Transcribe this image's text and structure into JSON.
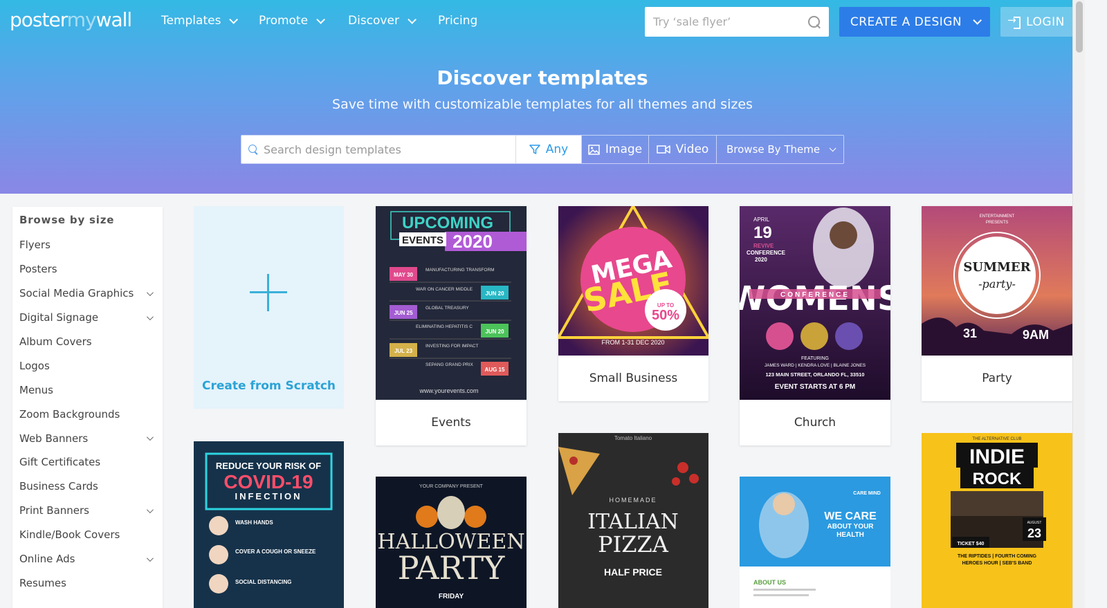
{
  "brand": {
    "logo_left": "poster",
    "logo_mid": "my",
    "logo_right": "wall"
  },
  "nav": {
    "items": [
      {
        "label": "Templates",
        "dropdown": true
      },
      {
        "label": "Promote",
        "dropdown": true
      },
      {
        "label": "Discover",
        "dropdown": true
      },
      {
        "label": "Pricing",
        "dropdown": false
      }
    ],
    "search_placeholder": "Try ‘sale flyer’",
    "create_label": "CREATE A DESIGN",
    "login_label": "LOGIN"
  },
  "hero": {
    "title": "Discover templates",
    "subtitle": "Save time with customizable templates for all themes and sizes"
  },
  "filter": {
    "search_placeholder": "Search design templates",
    "any_label": "Any",
    "image_label": "Image",
    "video_label": "Video",
    "theme_label": "Browse By Theme"
  },
  "sidebar": {
    "title": "Browse by size",
    "items": [
      {
        "label": "Flyers",
        "expandable": false
      },
      {
        "label": "Posters",
        "expandable": false
      },
      {
        "label": "Social Media Graphics",
        "expandable": true
      },
      {
        "label": "Digital Signage",
        "expandable": true
      },
      {
        "label": "Album Covers",
        "expandable": false
      },
      {
        "label": "Logos",
        "expandable": false
      },
      {
        "label": "Menus",
        "expandable": false
      },
      {
        "label": "Zoom Backgrounds",
        "expandable": false
      },
      {
        "label": "Web Banners",
        "expandable": true
      },
      {
        "label": "Gift Certificates",
        "expandable": false
      },
      {
        "label": "Business Cards",
        "expandable": false
      },
      {
        "label": "Print Banners",
        "expandable": true
      },
      {
        "label": "Kindle/Book Covers",
        "expandable": false
      },
      {
        "label": "Online Ads",
        "expandable": true
      },
      {
        "label": "Resumes",
        "expandable": false
      }
    ]
  },
  "grid": {
    "scratch_label": "Create from Scratch",
    "cards": {
      "events": "Events",
      "small_business": "Small Business",
      "church": "Church",
      "party": "Party"
    },
    "posters": {
      "events": {
        "title1": "UPCOMING",
        "title2": "EVENTS",
        "year": "2020",
        "rows": [
          {
            "date": "MAY 30",
            "text": "MANUFACTURING TRANSFORM"
          },
          {
            "date": "JUN 20",
            "text": "WAR ON CANCER MIDDLE"
          },
          {
            "date": "JUN 25",
            "text": "GLOBAL TREASURY"
          },
          {
            "date": "JUN 20",
            "text": "ELIMINATING HEPATITIS C"
          },
          {
            "date": "JUL 23",
            "text": "INVESTING FOR IMPACT"
          },
          {
            "date": "AUG 15",
            "text": "SEPANG GRAND PRIX"
          }
        ],
        "footer": "www.yourevents.com"
      },
      "sale": {
        "line1": "MEGA",
        "line2": "SALE",
        "badge1": "UP TO",
        "badge2": "50%",
        "footer": "FROM 1-31 DEC 2020"
      },
      "church": {
        "month": "APRIL",
        "day": "19",
        "tag1": "REVIVE",
        "tag2": "CONFERENCE",
        "tag3": "2020",
        "title": "WOMENS",
        "subtitle": "CONFERENCE",
        "featuring": "FEATURING",
        "names": "JAMES WARD | KENDRA LOVE | BLAINE JONES",
        "address": "123 MAIN STREET, ORLANDO FL, 33510",
        "start": "EVENT STARTS AT 6 PM"
      },
      "party": {
        "top1": "ENTERTAINMENT",
        "top2": "PRESENTS",
        "line1": "SUMMER",
        "line2": "-party-",
        "date": "31",
        "time": "9AM"
      },
      "covid": {
        "line1": "REDUCE YOUR RISK OF",
        "line2": "COVID-19",
        "line3": "INFECTION",
        "items": [
          "WASH HANDS",
          "COVER A COUGH OR SNEEZE",
          "SOCIAL DISTANCING"
        ]
      },
      "halloween": {
        "top": "YOUR COMPANY PRESENT",
        "line1": "HALLOWEEN",
        "line2": "PARTY",
        "day": "FRIDAY"
      },
      "pizza": {
        "top": "Tomato Italiano",
        "small": "HOMEMADE",
        "line1": "ITALIAN",
        "line2": "PIZZA",
        "price": "HALF PRICE"
      },
      "care": {
        "brand": "CARE MIND",
        "line1": "WE CARE",
        "line2": "ABOUT YOUR",
        "line3": "HEALTH",
        "about": "ABOUT US"
      },
      "indie": {
        "top": "THE ALTERNATIVE CLUB",
        "line1": "INDIE",
        "line2": "ROCK",
        "ticket": "TICKET $40",
        "month": "AUGUST",
        "day": "23",
        "bands": "THE RIPTIDES | FOURTH COMING",
        "bands2": "HEROES HOUR | SEB'S BAND"
      }
    }
  }
}
